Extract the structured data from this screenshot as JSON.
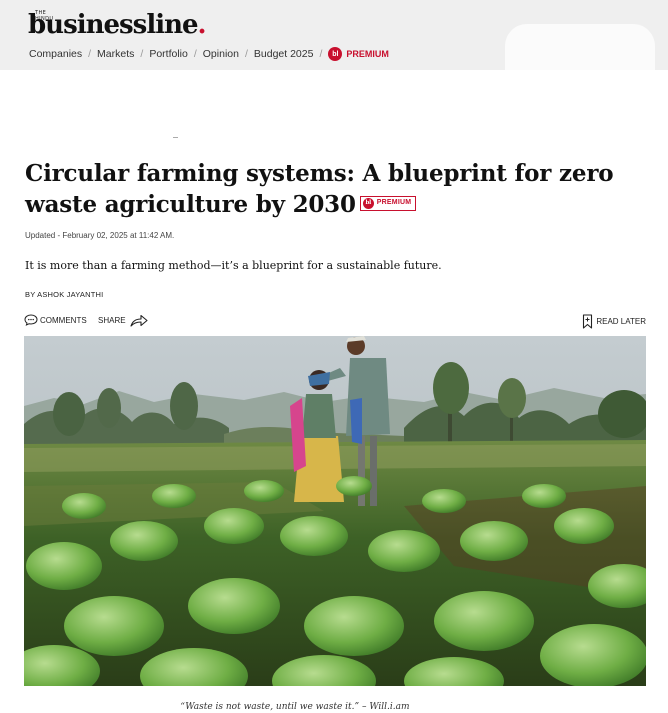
{
  "header": {
    "logo_small": "THE HINDU",
    "logo_text": "businessline",
    "logo_dot": ".",
    "nav": [
      "Companies",
      "Markets",
      "Portfolio",
      "Opinion",
      "Budget 2025"
    ],
    "premium_badge": "bl",
    "premium_label": "PREMIUM"
  },
  "article": {
    "headline": "Circular farming systems: A blueprint for zero waste agriculture by 2030",
    "premium_badge": "bl",
    "premium_label": "PREMIUM",
    "updated": "Updated - February 02, 2025 at 11:42 AM.",
    "standfirst": "It is more than a farming method—it’s a blueprint for a sustainable future.",
    "byline": "BY ASHOK JAYANTHI"
  },
  "actions": {
    "comments": "COMMENTS",
    "share": "SHARE",
    "read_later": "READ LATER"
  },
  "photo": {
    "caption": "“Waste is not waste, until we waste it.” – Will.i.am"
  },
  "colors": {
    "brand_red": "#c8102e",
    "header_bg": "#efefef"
  },
  "icons": {
    "comments": "comment-bubble-icon",
    "share": "share-arrow-icon",
    "read_later": "bookmark-icon"
  }
}
